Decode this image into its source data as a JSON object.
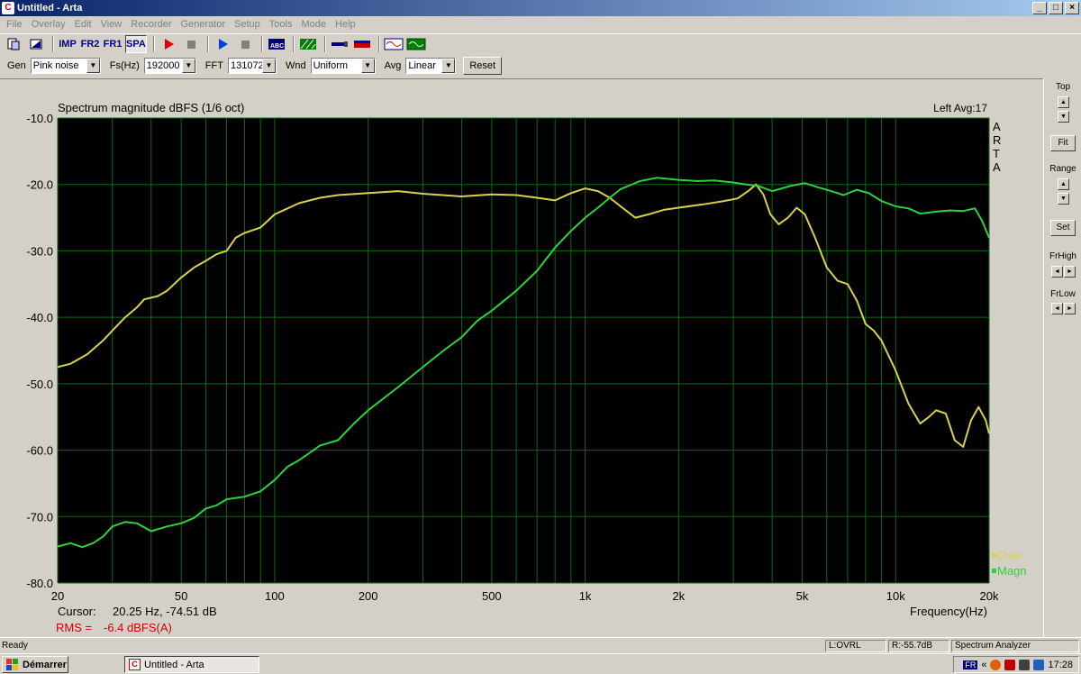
{
  "window": {
    "title": "Untitled - Arta",
    "min": "_",
    "max": "□",
    "close": "×"
  },
  "menu": [
    "File",
    "Overlay",
    "Edit",
    "View",
    "Recorder",
    "Generator",
    "Setup",
    "Tools",
    "Mode",
    "Help"
  ],
  "toolbar": {
    "imp": "IMP",
    "fr2": "FR2",
    "fr1": "FR1",
    "spa": "SPA"
  },
  "controls": {
    "gen_label": "Gen",
    "gen_value": "Pink noise",
    "fs_label": "Fs(Hz)",
    "fs_value": "192000",
    "fft_label": "FFT",
    "fft_value": "131072",
    "wnd_label": "Wnd",
    "wnd_value": "Uniform",
    "avg_label": "Avg",
    "avg_value": "Linear",
    "reset_label": "Reset"
  },
  "graph": {
    "title": "Spectrum magnitude dBFS (1/6 oct)",
    "channel": "Left  Avg:17",
    "watermark": [
      "A",
      "R",
      "T",
      "A"
    ],
    "xlabel": "Frequency(Hz)",
    "cursor_label": "Cursor:",
    "cursor_value": "20.25 Hz, -74.51 dB",
    "rms_label": "RMS =",
    "rms_value": "-6.4 dBFS(A)",
    "colors": {
      "bg": "#000000",
      "grid": "#0d6b0d",
      "over": "#d8d050",
      "magn": "#30d040",
      "rms": "#cc0000"
    }
  },
  "chart_data": {
    "type": "line",
    "title": "Spectrum magnitude dBFS (1/6 oct)",
    "xlabel": "Frequency(Hz)",
    "ylabel": "",
    "xscale": "log",
    "xlim": [
      20,
      20000
    ],
    "ylim": [
      -80,
      -10
    ],
    "grid": true,
    "legend": "bottom-right",
    "x_ticks": [
      {
        "v": 20,
        "label": "20"
      },
      {
        "v": 50,
        "label": "50"
      },
      {
        "v": 100,
        "label": "100"
      },
      {
        "v": 200,
        "label": "200"
      },
      {
        "v": 500,
        "label": "500"
      },
      {
        "v": 1000,
        "label": "1k"
      },
      {
        "v": 2000,
        "label": "2k"
      },
      {
        "v": 5000,
        "label": "5k"
      },
      {
        "v": 10000,
        "label": "10k"
      },
      {
        "v": 20000,
        "label": "20k"
      }
    ],
    "y_ticks": [
      {
        "v": -10,
        "label": "-10.0"
      },
      {
        "v": -20,
        "label": "-20.0"
      },
      {
        "v": -30,
        "label": "-30.0"
      },
      {
        "v": -40,
        "label": "-40.0"
      },
      {
        "v": -50,
        "label": "-50.0"
      },
      {
        "v": -60,
        "label": "-60.0"
      },
      {
        "v": -70,
        "label": "-70.0"
      },
      {
        "v": -80,
        "label": "-80.0"
      }
    ],
    "series": [
      {
        "name": "Over",
        "color": "#d8d050",
        "points": [
          [
            20,
            -47.5
          ],
          [
            22,
            -47
          ],
          [
            25,
            -45.5
          ],
          [
            28,
            -43.5
          ],
          [
            30,
            -42
          ],
          [
            33,
            -40
          ],
          [
            36,
            -38.5
          ],
          [
            38,
            -37.3
          ],
          [
            42,
            -36.8
          ],
          [
            45,
            -36
          ],
          [
            50,
            -34
          ],
          [
            55,
            -32.5
          ],
          [
            60,
            -31.5
          ],
          [
            65,
            -30.5
          ],
          [
            70,
            -30
          ],
          [
            75,
            -28
          ],
          [
            80,
            -27.3
          ],
          [
            90,
            -26.5
          ],
          [
            100,
            -24.5
          ],
          [
            110,
            -23.6
          ],
          [
            120,
            -22.8
          ],
          [
            140,
            -22
          ],
          [
            160,
            -21.6
          ],
          [
            200,
            -21.3
          ],
          [
            250,
            -21
          ],
          [
            300,
            -21.4
          ],
          [
            400,
            -21.8
          ],
          [
            500,
            -21.5
          ],
          [
            600,
            -21.6
          ],
          [
            700,
            -22
          ],
          [
            800,
            -22.4
          ],
          [
            900,
            -21.3
          ],
          [
            1000,
            -20.6
          ],
          [
            1100,
            -21
          ],
          [
            1200,
            -22
          ],
          [
            1300,
            -23.3
          ],
          [
            1450,
            -25
          ],
          [
            1600,
            -24.5
          ],
          [
            1800,
            -23.8
          ],
          [
            2000,
            -23.5
          ],
          [
            2400,
            -23
          ],
          [
            2800,
            -22.5
          ],
          [
            3100,
            -22.1
          ],
          [
            3350,
            -21
          ],
          [
            3550,
            -20
          ],
          [
            3750,
            -21.5
          ],
          [
            3950,
            -24.5
          ],
          [
            4200,
            -26
          ],
          [
            4500,
            -25
          ],
          [
            4800,
            -23.5
          ],
          [
            5100,
            -24.5
          ],
          [
            5500,
            -28
          ],
          [
            6000,
            -32.5
          ],
          [
            6500,
            -34.5
          ],
          [
            7000,
            -35
          ],
          [
            7500,
            -37.5
          ],
          [
            8000,
            -41
          ],
          [
            8500,
            -42
          ],
          [
            9000,
            -43.5
          ],
          [
            10000,
            -48
          ],
          [
            11000,
            -53
          ],
          [
            12000,
            -56
          ],
          [
            12800,
            -55
          ],
          [
            13500,
            -54
          ],
          [
            14500,
            -54.5
          ],
          [
            15500,
            -58.5
          ],
          [
            16500,
            -59.5
          ],
          [
            17500,
            -55.5
          ],
          [
            18500,
            -53.5
          ],
          [
            19500,
            -55.5
          ],
          [
            20000,
            -57.5
          ]
        ]
      },
      {
        "name": "Magn",
        "color": "#30d040",
        "points": [
          [
            20,
            -74.5
          ],
          [
            22,
            -74
          ],
          [
            24,
            -74.6
          ],
          [
            26,
            -74
          ],
          [
            28,
            -73
          ],
          [
            30,
            -71.5
          ],
          [
            33,
            -70.8
          ],
          [
            36,
            -71
          ],
          [
            40,
            -72.2
          ],
          [
            45,
            -71.5
          ],
          [
            50,
            -71
          ],
          [
            55,
            -70.2
          ],
          [
            60,
            -68.8
          ],
          [
            65,
            -68.3
          ],
          [
            70,
            -67.4
          ],
          [
            80,
            -67
          ],
          [
            90,
            -66.2
          ],
          [
            100,
            -64.5
          ],
          [
            110,
            -62.5
          ],
          [
            120,
            -61.5
          ],
          [
            140,
            -59.3
          ],
          [
            160,
            -58.5
          ],
          [
            180,
            -56
          ],
          [
            200,
            -54
          ],
          [
            250,
            -50.5
          ],
          [
            300,
            -47.5
          ],
          [
            350,
            -45
          ],
          [
            400,
            -43
          ],
          [
            450,
            -40.5
          ],
          [
            500,
            -39
          ],
          [
            600,
            -36
          ],
          [
            700,
            -33
          ],
          [
            800,
            -29.5
          ],
          [
            900,
            -27
          ],
          [
            1000,
            -25
          ],
          [
            1100,
            -23.5
          ],
          [
            1200,
            -22
          ],
          [
            1300,
            -20.7
          ],
          [
            1500,
            -19.5
          ],
          [
            1700,
            -19
          ],
          [
            2000,
            -19.3
          ],
          [
            2300,
            -19.5
          ],
          [
            2600,
            -19.4
          ],
          [
            3000,
            -19.7
          ],
          [
            3300,
            -20
          ],
          [
            3600,
            -20.2
          ],
          [
            4000,
            -21
          ],
          [
            4300,
            -20.6
          ],
          [
            4600,
            -20.2
          ],
          [
            5100,
            -19.8
          ],
          [
            5600,
            -20.4
          ],
          [
            6200,
            -21
          ],
          [
            6800,
            -21.6
          ],
          [
            7500,
            -20.8
          ],
          [
            8200,
            -21.3
          ],
          [
            9000,
            -22.5
          ],
          [
            10000,
            -23.3
          ],
          [
            11000,
            -23.6
          ],
          [
            12000,
            -24.4
          ],
          [
            13500,
            -24.1
          ],
          [
            15000,
            -23.9
          ],
          [
            16500,
            -24
          ],
          [
            18000,
            -23.6
          ],
          [
            19000,
            -25.5
          ],
          [
            20000,
            -28
          ]
        ]
      }
    ]
  },
  "right_panel": {
    "top_label": "Top",
    "fit_label": "Fit",
    "range_label": "Range",
    "set_label": "Set",
    "frhigh_label": "FrHigh",
    "frlow_label": "FrLow"
  },
  "status": {
    "ready": "Ready",
    "ovrl": "L:OVRL",
    "r": "R:-55.7dB",
    "mode": "Spectrum Analyzer"
  },
  "taskbar": {
    "start": "Démarrer",
    "task": "Untitled - Arta",
    "lang": "FR",
    "chevron": "«",
    "clock": "17:28"
  }
}
